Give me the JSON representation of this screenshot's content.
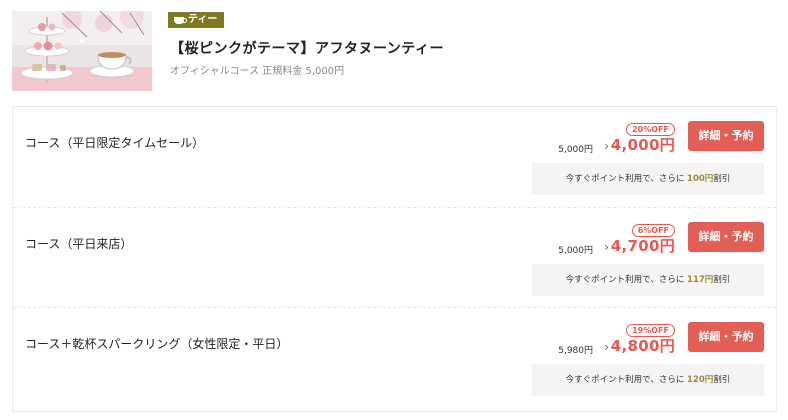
{
  "header": {
    "thumbnail_icon": "afternoon-tea-photo",
    "tag": {
      "icon": "cup-icon",
      "label": "ティー",
      "color": "#7d7a22"
    },
    "title": "【桜ピンクがテーマ】アフタヌーンティー",
    "subtitle": "オフィシャルコース 正規料金 5,000円"
  },
  "accent_color": "#e35f55",
  "courses": [
    {
      "name": "コース（平日限定タイムセール）",
      "original_price": "5,000円",
      "arrow": "›",
      "discount": "20%OFF",
      "sale_price": "4,000円",
      "button": "詳細・予約",
      "points": {
        "prefix": "今すぐポイント利用で、さらに",
        "amount": "100円",
        "suffix": "割引"
      }
    },
    {
      "name": "コース（平日来店）",
      "original_price": "5,000円",
      "arrow": "›",
      "discount": "6%OFF",
      "sale_price": "4,700円",
      "button": "詳細・予約",
      "points": {
        "prefix": "今すぐポイント利用で、さらに",
        "amount": "117円",
        "suffix": "割引"
      }
    },
    {
      "name": "コース＋乾杯スパークリング（女性限定・平日）",
      "original_price": "5,980円",
      "arrow": "›",
      "discount": "19%OFF",
      "sale_price": "4,800円",
      "button": "詳細・予約",
      "points": {
        "prefix": "今すぐポイント利用で、さらに",
        "amount": "120円",
        "suffix": "割引"
      }
    }
  ]
}
